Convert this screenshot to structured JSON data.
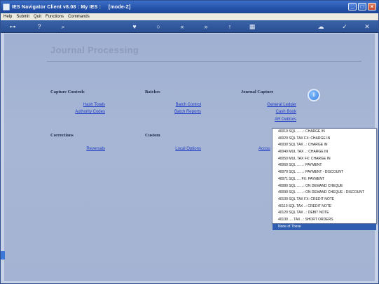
{
  "window": {
    "title": "IES Navigator Client v8.08 : My IES :     [mode-Z]"
  },
  "menu": {
    "items": [
      "Help",
      "Submit",
      "Quit",
      "Functions",
      "Commands"
    ]
  },
  "toolbar": {
    "icons": [
      "key-icon",
      "help-icon",
      "search-icon",
      "heart-icon",
      "refresh-icon",
      "back-icon",
      "forward-icon",
      "up-icon",
      "grid-icon",
      "cloud-icon",
      "check-icon",
      "close-icon"
    ]
  },
  "page": {
    "title": "Journal Processing"
  },
  "sections": {
    "capture_controls": {
      "heading": "Capture Controls",
      "links": [
        "Hash Totals",
        "Authority Codes"
      ]
    },
    "batches": {
      "heading": "Batches",
      "links": [
        "Batch Control",
        "Batch Reports"
      ]
    },
    "journal_capture": {
      "heading": "Journal Capture",
      "links": [
        "General Ledger",
        "Cash Book",
        "AR Debtors"
      ]
    },
    "corrections": {
      "heading": "Corrections",
      "links": [
        "Reversals"
      ]
    },
    "custom": {
      "heading": "Custom",
      "links": [
        "Local Options"
      ]
    },
    "partial_link": "Accou"
  },
  "dropdown": {
    "items": [
      "40010 SQL .... ..: CHARGE IN",
      "40020 SQL TAX FX: CHARGE IN",
      "40030 SQL TAX ..: CHARGE IN",
      "40040 MUL TAX ..: CHARGE IN",
      "40050 MUL TAX FX: CHARGE IN",
      "40060 SQL .... ..: PAYMENT",
      "40070 SQL .... ..: PAYMENT - DISCOUNT",
      "40071 SQL .... FX: PAYMENT",
      "40080 SQL .... ..: ON DEMAND CHEQUE",
      "40090 SQL .... ..: ON DEMAND CHEQUE - DISCOUNT",
      "40100 SQL TAX FX: CREDIT NOTE",
      "40110 SQL TAX ..: CREDIT NOTE",
      "40120 SQL TAX ..: DEBIT NOTE",
      "40130 .... TAX ..: SHORT ORDERS",
      "None of These"
    ],
    "selected_index": 14
  }
}
